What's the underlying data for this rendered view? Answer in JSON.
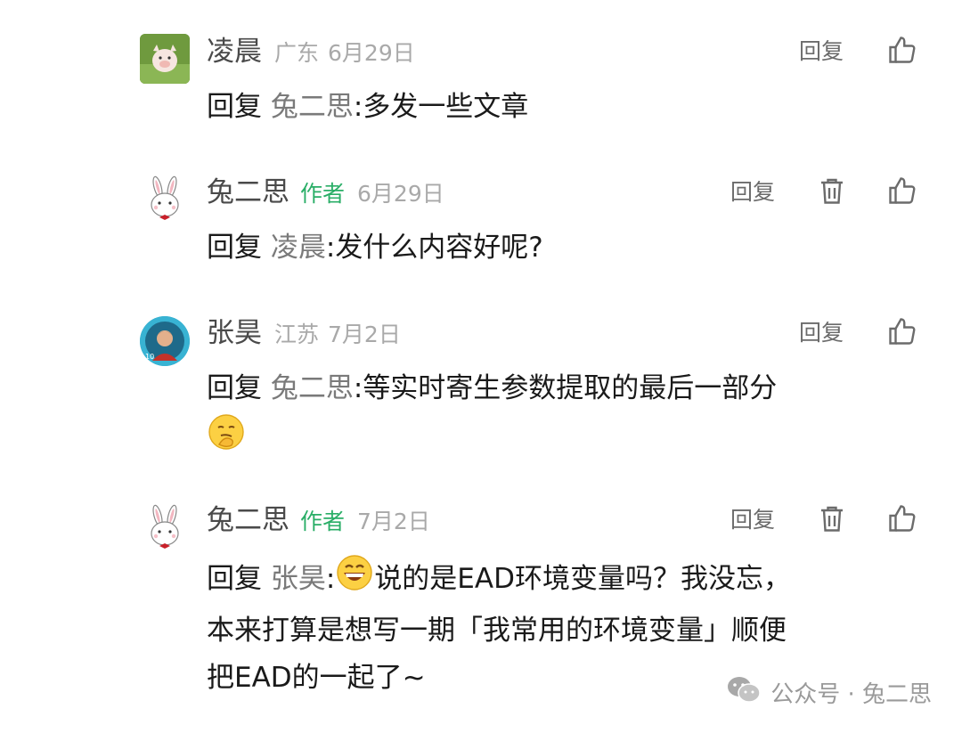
{
  "comments": [
    {
      "nick": "凌晨",
      "author_tag": "",
      "region": "广东",
      "date": "6月29日",
      "reply_label": "回复",
      "prefix": "回复",
      "target": "兔二思",
      "colon": ":",
      "text": "多发一些文章"
    },
    {
      "nick": "兔二思",
      "author_tag": "作者",
      "region": "",
      "date": "6月29日",
      "reply_label": "回复",
      "prefix": "回复",
      "target": "凌晨",
      "colon": ":",
      "text": "发什么内容好呢?"
    },
    {
      "nick": "张昊",
      "author_tag": "",
      "region": "江苏",
      "date": "7月2日",
      "reply_label": "回复",
      "prefix": "回复",
      "target": "兔二思",
      "colon": ":",
      "text": "等实时寄生参数提取的最后一部分"
    },
    {
      "nick": "兔二思",
      "author_tag": "作者",
      "region": "",
      "date": "7月2日",
      "reply_label": "回复",
      "prefix": "回复",
      "target": "张昊",
      "colon": ":",
      "text_line1": "说的是EAD环境变量吗？我没忘，",
      "text_line2": "本来打算是想写一期「我常用的环境变量」顺便",
      "text_line3": "把EAD的一起了~"
    }
  ],
  "footer": {
    "label": "公众号 · 兔二思"
  },
  "colors": {
    "author_tag": "#2aae67",
    "meta": "#a9a9a9",
    "action": "#6b6b6b"
  },
  "icons": [
    "pig-avatar",
    "rabbit-avatar",
    "child-avatar",
    "thumbs-up-icon",
    "trash-icon",
    "thinking-emoji",
    "grin-emoji",
    "wechat-icon"
  ]
}
